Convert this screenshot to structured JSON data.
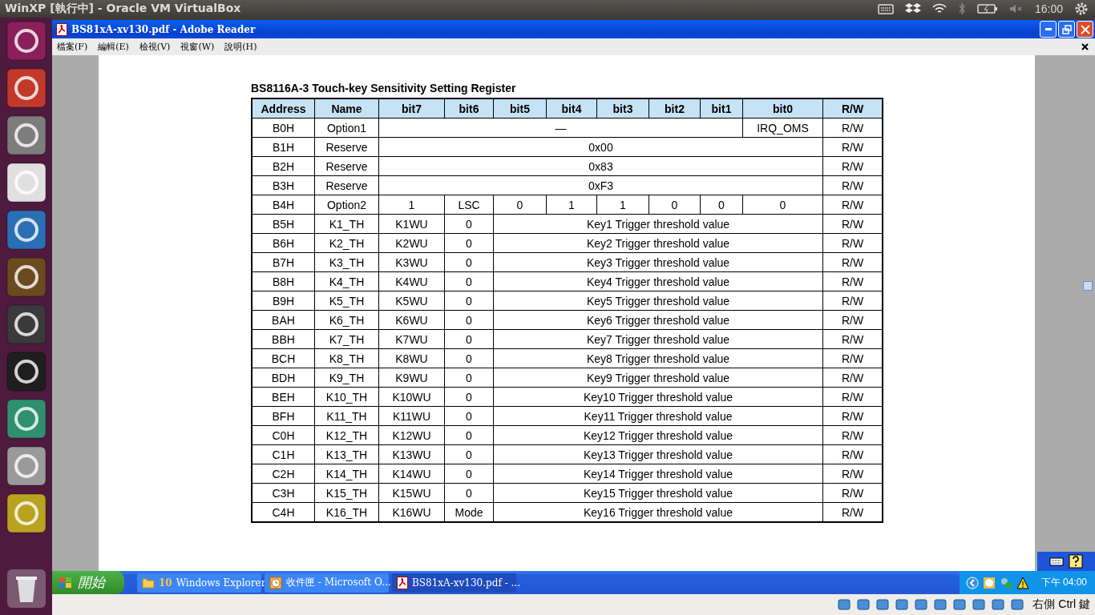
{
  "top_panel": {
    "title": "WinXP [執行中] - Oracle VM VirtualBox",
    "clock": "16:00"
  },
  "window": {
    "title": "BS81xA-xv130.pdf - Adobe Reader"
  },
  "menu": [
    "檔案(F)",
    "編輯(E)",
    "檢視(V)",
    "視窗(W)",
    "說明(H)"
  ],
  "document": {
    "heading": "BS8116A-3 Touch-key Sensitivity Setting Register",
    "columns": [
      "Address",
      "Name",
      "bit7",
      "bit6",
      "bit5",
      "bit4",
      "bit3",
      "bit2",
      "bit1",
      "bit0",
      "R/W"
    ],
    "rows": [
      {
        "cells": [
          "B0H",
          "Option1",
          "—",
          "",
          "",
          "",
          "",
          "",
          "",
          "IRQ_OMS",
          "R/W"
        ]
      },
      {
        "cells": [
          "B1H",
          "Reserve",
          "0x00",
          "",
          "",
          "",
          "",
          "",
          "",
          "",
          "R/W"
        ]
      },
      {
        "cells": [
          "B2H",
          "Reserve",
          "0x83",
          "",
          "",
          "",
          "",
          "",
          "",
          "",
          "R/W"
        ]
      },
      {
        "cells": [
          "B3H",
          "Reserve",
          "0xF3",
          "",
          "",
          "",
          "",
          "",
          "",
          "",
          "R/W"
        ]
      },
      {
        "cells": [
          "B4H",
          "Option2",
          "1",
          "LSC",
          "0",
          "1",
          "1",
          "0",
          "0",
          "0",
          "R/W"
        ]
      },
      {
        "cells": [
          "B5H",
          "K1_TH",
          "K1WU",
          "0",
          "Key1 Trigger threshold value",
          "",
          "",
          "",
          "",
          "",
          "R/W"
        ]
      },
      {
        "cells": [
          "B6H",
          "K2_TH",
          "K2WU",
          "0",
          "Key2 Trigger threshold value",
          "",
          "",
          "",
          "",
          "",
          "R/W"
        ]
      },
      {
        "cells": [
          "B7H",
          "K3_TH",
          "K3WU",
          "0",
          "Key3 Trigger threshold value",
          "",
          "",
          "",
          "",
          "",
          "R/W"
        ]
      },
      {
        "cells": [
          "B8H",
          "K4_TH",
          "K4WU",
          "0",
          "Key4 Trigger threshold value",
          "",
          "",
          "",
          "",
          "",
          "R/W"
        ]
      },
      {
        "cells": [
          "B9H",
          "K5_TH",
          "K5WU",
          "0",
          "Key5 Trigger threshold value",
          "",
          "",
          "",
          "",
          "",
          "R/W"
        ]
      },
      {
        "cells": [
          "BAH",
          "K6_TH",
          "K6WU",
          "0",
          "Key6 Trigger threshold value",
          "",
          "",
          "",
          "",
          "",
          "R/W"
        ]
      },
      {
        "cells": [
          "BBH",
          "K7_TH",
          "K7WU",
          "0",
          "Key7 Trigger threshold value",
          "",
          "",
          "",
          "",
          "",
          "R/W"
        ]
      },
      {
        "cells": [
          "BCH",
          "K8_TH",
          "K8WU",
          "0",
          "Key8 Trigger threshold value",
          "",
          "",
          "",
          "",
          "",
          "R/W"
        ]
      },
      {
        "cells": [
          "BDH",
          "K9_TH",
          "K9WU",
          "0",
          "Key9 Trigger threshold value",
          "",
          "",
          "",
          "",
          "",
          "R/W"
        ]
      },
      {
        "cells": [
          "BEH",
          "K10_TH",
          "K10WU",
          "0",
          "Key10 Trigger threshold value",
          "",
          "",
          "",
          "",
          "",
          "R/W"
        ]
      },
      {
        "cells": [
          "BFH",
          "K11_TH",
          "K11WU",
          "0",
          "Key11 Trigger threshold value",
          "",
          "",
          "",
          "",
          "",
          "R/W"
        ]
      },
      {
        "cells": [
          "C0H",
          "K12_TH",
          "K12WU",
          "0",
          "Key12 Trigger threshold value",
          "",
          "",
          "",
          "",
          "",
          "R/W"
        ]
      },
      {
        "cells": [
          "C1H",
          "K13_TH",
          "K13WU",
          "0",
          "Key13 Trigger threshold value",
          "",
          "",
          "",
          "",
          "",
          "R/W"
        ]
      },
      {
        "cells": [
          "C2H",
          "K14_TH",
          "K14WU",
          "0",
          "Key14 Trigger threshold value",
          "",
          "",
          "",
          "",
          "",
          "R/W"
        ]
      },
      {
        "cells": [
          "C3H",
          "K15_TH",
          "K15WU",
          "0",
          "Key15 Trigger threshold value",
          "",
          "",
          "",
          "",
          "",
          "R/W"
        ]
      },
      {
        "cells": [
          "C4H",
          "K16_TH",
          "K16WU",
          "Mode",
          "Key16 Trigger threshold value",
          "",
          "",
          "",
          "",
          "",
          "R/W"
        ]
      }
    ]
  },
  "taskbar": {
    "start": "開始",
    "tasks": [
      {
        "kind": "folder",
        "count": "10",
        "label": "Windows Explorer",
        "selected": false
      },
      {
        "kind": "clock",
        "label": "收件匣 - Microsoft O...",
        "selected": false
      },
      {
        "kind": "pdf",
        "label": "BS81xA-xv130.pdf - ...",
        "selected": true
      }
    ],
    "clock": "下午 04:00"
  },
  "status_bar": {
    "host_key": "右側 Ctrl 鍵"
  }
}
